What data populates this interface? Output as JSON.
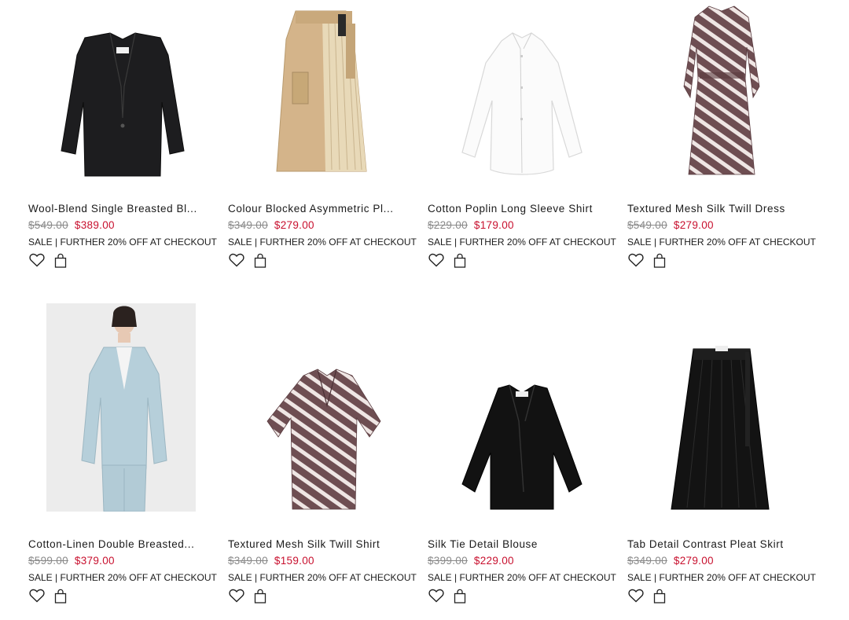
{
  "products": [
    {
      "name": "Wool-Blend Single Breasted Bl...",
      "was": "$549.00",
      "now": "$389.00",
      "promo": "SALE | FURTHER 20% OFF AT CHECKOUT",
      "image": "black-blazer"
    },
    {
      "name": "Colour Blocked Asymmetric Pl...",
      "was": "$349.00",
      "now": "$279.00",
      "promo": "SALE | FURTHER 20% OFF AT CHECKOUT",
      "image": "beige-pleated-skirt"
    },
    {
      "name": "Cotton Poplin Long Sleeve Shirt",
      "was": "$229.00",
      "now": "$179.00",
      "promo": "SALE | FURTHER 20% OFF AT CHECKOUT",
      "image": "white-shirt"
    },
    {
      "name": "Textured Mesh Silk Twill Dress",
      "was": "$549.00",
      "now": "$279.00",
      "promo": "SALE | FURTHER 20% OFF AT CHECKOUT",
      "image": "zebra-print-dress"
    },
    {
      "name": "Cotton-Linen Double Breasted...",
      "was": "$599.00",
      "now": "$379.00",
      "promo": "SALE | FURTHER 20% OFF AT CHECKOUT",
      "image": "model-light-blue-suit"
    },
    {
      "name": "Textured Mesh Silk Twill Shirt",
      "was": "$349.00",
      "now": "$159.00",
      "promo": "SALE | FURTHER 20% OFF AT CHECKOUT",
      "image": "zebra-print-shirt"
    },
    {
      "name": "Silk Tie Detail Blouse",
      "was": "$399.00",
      "now": "$229.00",
      "promo": "SALE | FURTHER 20% OFF AT CHECKOUT",
      "image": "black-blouse"
    },
    {
      "name": "Tab Detail Contrast Pleat Skirt",
      "was": "$349.00",
      "now": "$279.00",
      "promo": "SALE | FURTHER 20% OFF AT CHECKOUT",
      "image": "black-pleated-skirt"
    }
  ],
  "icons": {
    "wishlist": "heart-icon",
    "bag": "shopping-bag-icon"
  },
  "colors": {
    "sale_price": "#c8102e",
    "original_price": "#8a8a8a",
    "text": "#1a1a1a"
  }
}
